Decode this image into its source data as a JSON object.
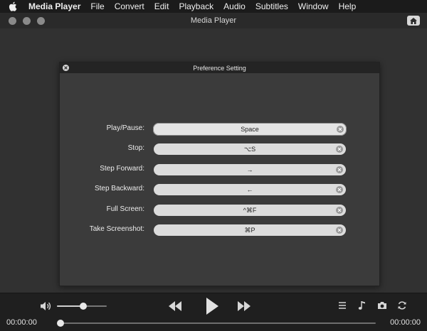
{
  "menubar": {
    "items": [
      "Media Player",
      "File",
      "Convert",
      "Edit",
      "Playback",
      "Audio",
      "Subtitles",
      "Window",
      "Help"
    ]
  },
  "window": {
    "title": "Media Player"
  },
  "preferences": {
    "title": "Preference Setting",
    "rows": [
      {
        "label": "Play/Pause:",
        "value": "Space",
        "active": true
      },
      {
        "label": "Stop:",
        "value": "⌥S"
      },
      {
        "label": "Step Forward:",
        "value": "→"
      },
      {
        "label": "Step Backward:",
        "value": "←"
      },
      {
        "label": "Full Screen:",
        "value": "^⌘F"
      },
      {
        "label": "Take Screenshot:",
        "value": "⌘P"
      }
    ]
  },
  "controls": {
    "volume_fraction": 0.53,
    "seek_fraction": 0.0,
    "time_current": "00:00:00",
    "time_total": "00:00:00"
  },
  "colors": {
    "accent": "#e8e8e8",
    "background": "#2f2f2f",
    "field": "#dcdcdc"
  }
}
